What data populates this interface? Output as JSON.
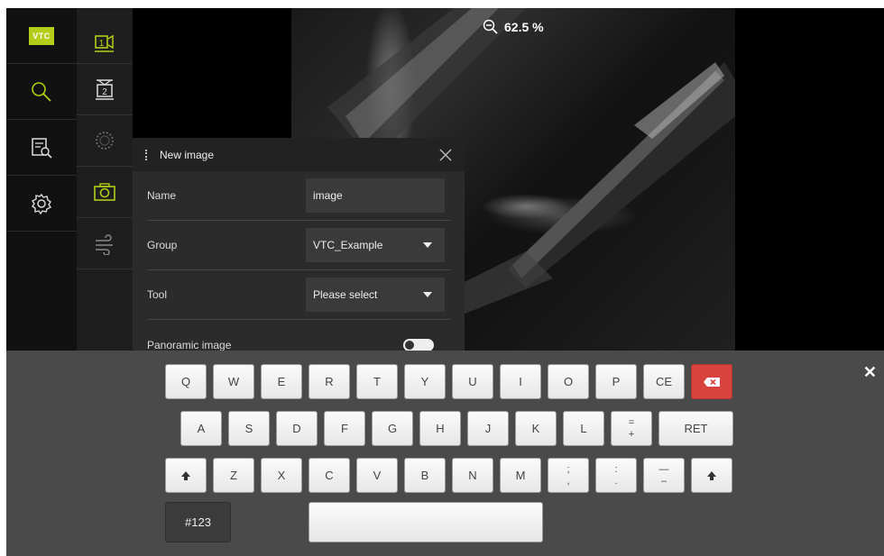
{
  "app": {
    "logo": "VTC"
  },
  "sidebar": {
    "items": [
      {
        "name": "inspect",
        "icon": "magnifier-icon"
      },
      {
        "name": "reports",
        "icon": "report-search-icon"
      },
      {
        "name": "settings",
        "icon": "gear-icon"
      }
    ]
  },
  "toolbar": {
    "items": [
      {
        "name": "camera-1",
        "icon": "camera-1-icon",
        "active": true
      },
      {
        "name": "camera-2",
        "icon": "camera-2-icon"
      },
      {
        "name": "brightness",
        "icon": "light-ring-icon"
      },
      {
        "name": "capture",
        "icon": "camera-icon",
        "active": true
      },
      {
        "name": "airflow",
        "icon": "air-icon"
      }
    ]
  },
  "view": {
    "zoom_label": "62.5 %"
  },
  "dialog": {
    "title": "New image",
    "fields": {
      "name": {
        "label": "Name",
        "value": "image"
      },
      "group": {
        "label": "Group",
        "value": "VTC_Example"
      },
      "tool": {
        "label": "Tool",
        "value": "Please select"
      },
      "panoramic": {
        "label": "Panoramic image",
        "enabled": false
      }
    }
  },
  "keyboard": {
    "row1": [
      "Q",
      "W",
      "E",
      "R",
      "T",
      "Y",
      "U",
      "I",
      "O",
      "P",
      "CE"
    ],
    "row2": [
      "A",
      "S",
      "D",
      "F",
      "G",
      "H",
      "J",
      "K",
      "L"
    ],
    "row2_special": {
      "eq_top": "=",
      "eq_bottom": "+",
      "ret": "RET"
    },
    "row3": [
      "Z",
      "X",
      "C",
      "V",
      "B",
      "N",
      "M"
    ],
    "row3_special": {
      "semi_top": ";",
      "semi_bottom": ",",
      "colon_top": ":",
      "colon_bottom": ".",
      "dash_top": "—",
      "dash_bottom": "–"
    },
    "mode_key": "#123",
    "space_key": "",
    "colors": {
      "accent": "#b5cc18",
      "delete": "#d9433e"
    }
  }
}
